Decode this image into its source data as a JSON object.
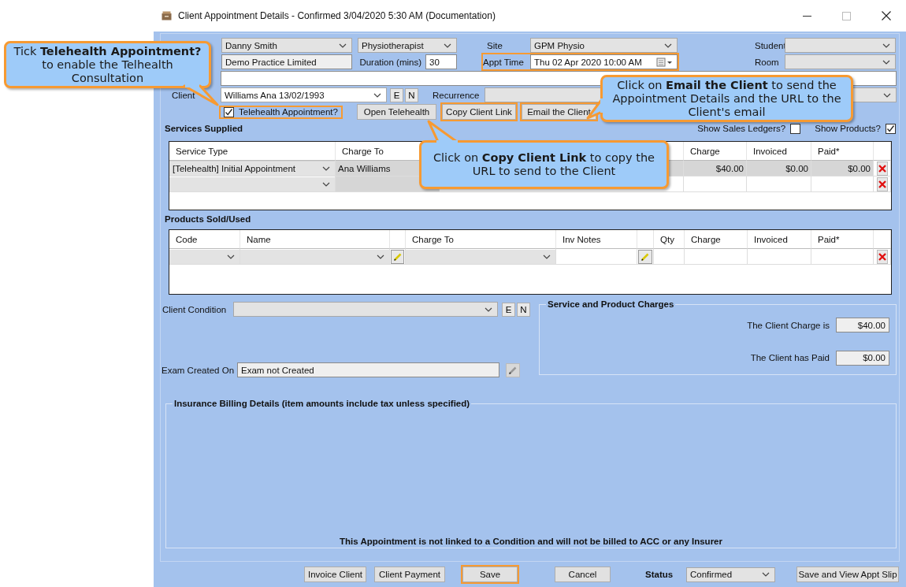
{
  "window": {
    "title": "Client Appointment Details - Confirmed 3/04/2020 5:30 AM (Documentation)"
  },
  "appointment": {
    "practitioner": "Danny Smith",
    "profession": "Physiotherapist",
    "site_label": "Site",
    "site": "GPM Physio",
    "student_label": "Student",
    "practice": "Demo Practice Limited",
    "duration_label": "Duration (mins)",
    "duration": "30",
    "appt_time_label": "Appt Time",
    "appt_time": "Thu  02  Apr  2020 10:00 AM",
    "appt_time_highlighted": true,
    "room_label": "Room",
    "client_label": "Client",
    "client": "Williams Ana 13/02/1993",
    "edit_button": "E",
    "new_button": "N",
    "recurrence_label": "Recurrence"
  },
  "telehealth": {
    "label": "Telehealth Appointment?",
    "checked": true,
    "highlighted": true
  },
  "action_buttons": [
    {
      "label": "Open Telehealth",
      "highlighted": false
    },
    {
      "label": "Copy Client Link",
      "highlighted": true
    },
    {
      "label": "Email the Client",
      "highlighted": true
    }
  ],
  "options": [
    {
      "label": "Show Sales Ledgers?",
      "checked": false
    },
    {
      "label": "Show Products?",
      "checked": true
    }
  ],
  "services": {
    "title": "Services Supplied",
    "columns": [
      "Service Type",
      "Charge To",
      "Charge",
      "Invoiced",
      "Paid*"
    ],
    "rows": [
      {
        "kind": "entry",
        "service_type": "[Telehealth] Initial Appointment",
        "charge_to": "Ana Williams",
        "charge": "$40.00",
        "invoiced": "$0.00",
        "paid": "$0.00"
      },
      {
        "kind": "new"
      }
    ]
  },
  "products": {
    "title": "Products Sold/Used",
    "columns": [
      "Code",
      "Name",
      "Charge To",
      "Inv Notes",
      "Qty",
      "Charge",
      "Invoiced",
      "Paid*"
    ],
    "rows": [
      {
        "kind": "new"
      }
    ]
  },
  "condition": {
    "label": "Client Condition",
    "edit_button": "E",
    "new_button": "N",
    "exam_label": "Exam Created On",
    "exam_value": "Exam not Created"
  },
  "charges": {
    "title": "Service and Product Charges",
    "rows": [
      {
        "label": "The Client Charge is",
        "value": "$40.00"
      },
      {
        "label": "The Client has Paid",
        "value": "$0.00"
      }
    ]
  },
  "insurance": {
    "title": "Insurance Billing Details (item amounts include tax unless specified)",
    "message": "This Appointment is not linked to a Condition and will not be billed to ACC or any Insurer"
  },
  "footer": {
    "buttons": [
      {
        "label": "Invoice Client",
        "highlighted": false
      },
      {
        "label": "Client Payment",
        "highlighted": false
      },
      {
        "label": "Save",
        "highlighted": true
      },
      {
        "label": "Cancel",
        "highlighted": false
      }
    ],
    "status_label": "Status",
    "status": "Confirmed",
    "slip_button": "Save and View Appt Slip"
  },
  "callouts": [
    {
      "text": "Tick **Telehealth Appointment?** to enable the Telhealth Consultation"
    },
    {
      "text": "Click on **Copy Client Link** to copy the URL to send to the Client"
    },
    {
      "text": "Click on **Email the Client** to send the Appointment Details and the URL to the Client's email"
    }
  ]
}
